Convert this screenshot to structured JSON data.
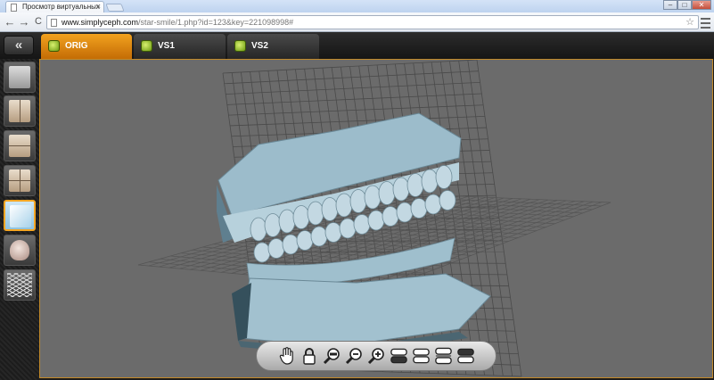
{
  "browser": {
    "tab_title": "Просмотр виртуальных",
    "tab_close": "×",
    "url_host": "www.simplyceph.com",
    "url_path": "/star-smile/1.php?id=123&key=221098998#",
    "back": "←",
    "forward": "→",
    "reload": "C",
    "star": "☆",
    "win_min": "–",
    "win_max": "□",
    "win_close": "✕"
  },
  "app": {
    "back_button": "«",
    "tabs": [
      {
        "label": "ORIG",
        "active": true
      },
      {
        "label": "VS1",
        "active": false
      },
      {
        "label": "VS2",
        "active": false
      }
    ],
    "sidebar_views": [
      "profile-view",
      "frontal-view",
      "upper-lower-view",
      "quad-view",
      "light-view",
      "skull-view",
      "grid-view"
    ],
    "active_view": "light-view",
    "bottom_tools": [
      "hand-icon",
      "lock-icon",
      "zoom-reset-icon",
      "zoom-out-icon",
      "zoom-in-icon",
      "upper-jaw-icon",
      "both-jaws-icon",
      "split-jaws-icon",
      "lower-jaw-icon"
    ],
    "colors": {
      "active_tab": "#e88a0c",
      "viewport_bg": "#6b6b6b",
      "model": "#a9c6d3"
    }
  }
}
